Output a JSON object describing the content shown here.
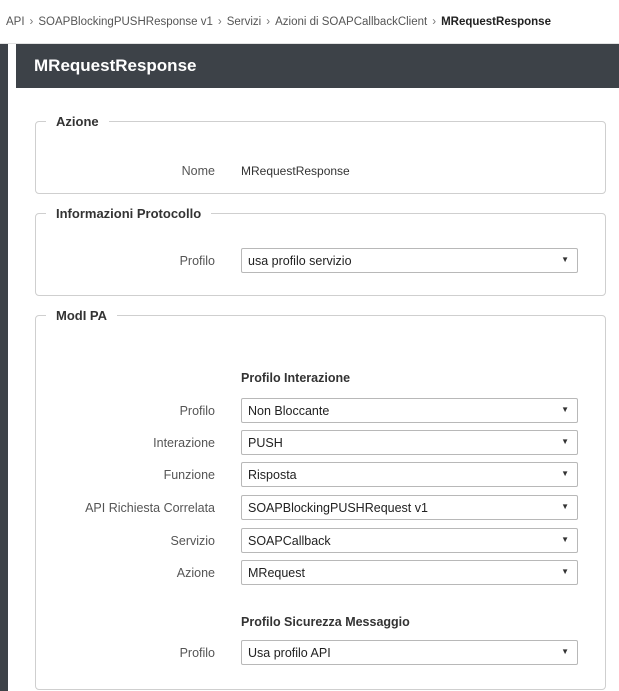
{
  "breadcrumb": {
    "items": [
      "API",
      "SOAPBlockingPUSHResponse v1",
      "Servizi",
      "Azioni di SOAPCallbackClient"
    ],
    "current": "MRequestResponse",
    "separator": "›"
  },
  "page": {
    "title": "MRequestResponse"
  },
  "azione": {
    "legend": "Azione",
    "nome_label": "Nome",
    "nome_value": "MRequestResponse"
  },
  "protocollo": {
    "legend": "Informazioni Protocollo",
    "profilo_label": "Profilo",
    "profilo_value": "usa profilo servizio"
  },
  "modi": {
    "legend": "ModI PA",
    "interazione_heading": "Profilo Interazione",
    "fields": [
      {
        "label": "Profilo",
        "value": "Non Bloccante"
      },
      {
        "label": "Interazione",
        "value": "PUSH"
      },
      {
        "label": "Funzione",
        "value": "Risposta"
      },
      {
        "label": "API Richiesta Correlata",
        "value": "SOAPBlockingPUSHRequest v1"
      },
      {
        "label": "Servizio",
        "value": "SOAPCallback"
      },
      {
        "label": "Azione",
        "value": "MRequest"
      }
    ],
    "sicurezza_heading": "Profilo Sicurezza Messaggio",
    "sicurezza_profilo_label": "Profilo",
    "sicurezza_profilo_value": "Usa profilo API"
  },
  "icons": {
    "dropdown": "▼"
  },
  "colors": {
    "title_bar": "#3d4248",
    "border": "#cfcfcf"
  }
}
